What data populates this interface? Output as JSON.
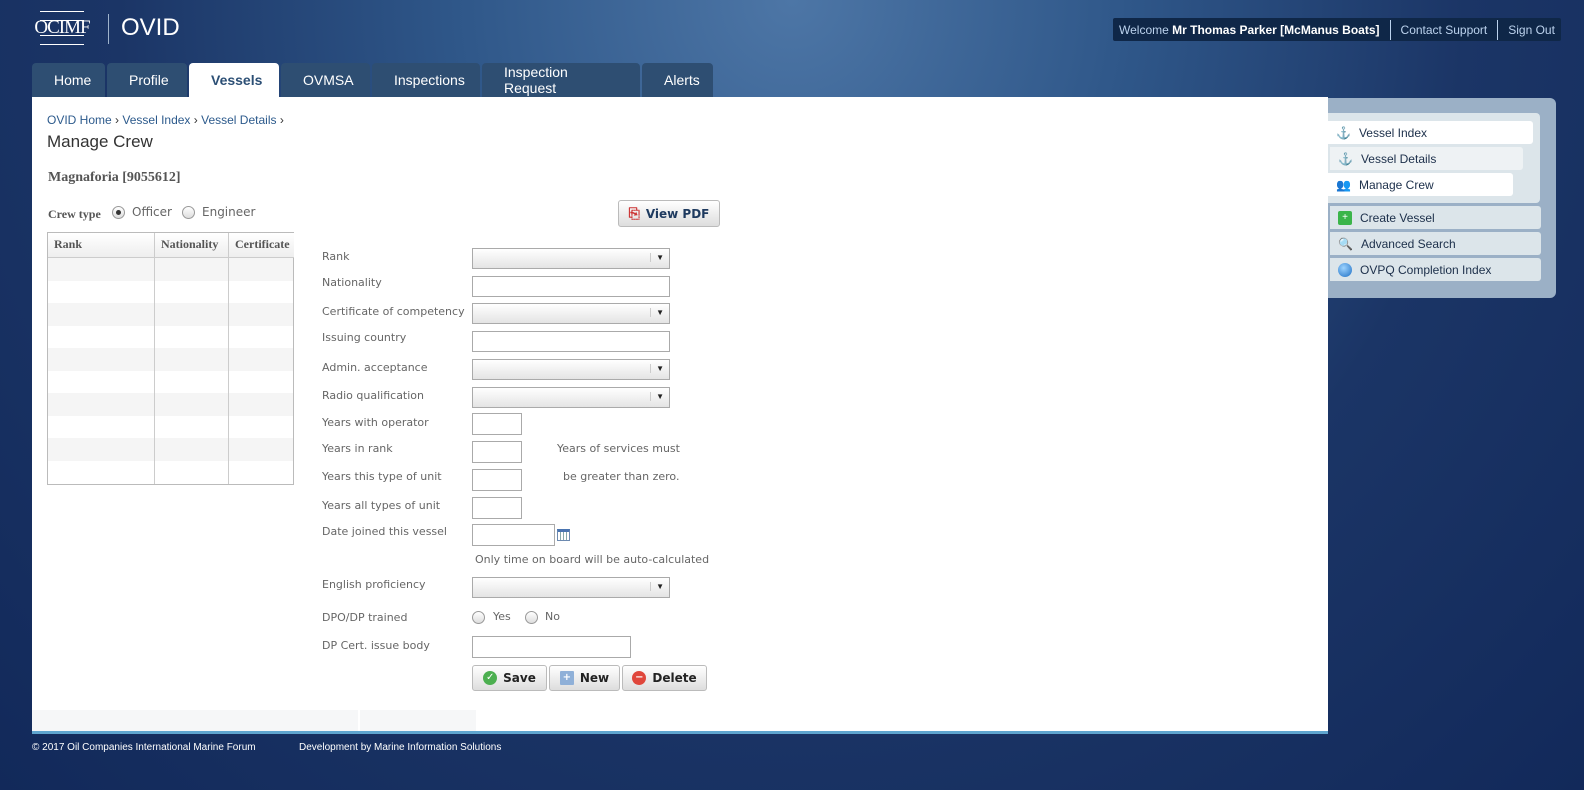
{
  "header": {
    "logo": "OCIMF",
    "app_name": "OVID",
    "welcome": "Welcome",
    "user": "Mr Thomas Parker [McManus Boats]",
    "contact": "Contact Support",
    "signout": "Sign Out"
  },
  "tabs": [
    "Home",
    "Profile",
    "Vessels",
    "OVMSA",
    "Inspections",
    "Inspection Request",
    "Alerts"
  ],
  "active_tab": "Vessels",
  "breadcrumb": [
    "OVID Home",
    "Vessel Index",
    "Vessel Details"
  ],
  "page_title": "Manage Crew",
  "vessel": "Magnaforia [9055612]",
  "crew_type": {
    "label": "Crew type",
    "options": [
      "Officer",
      "Engineer"
    ],
    "selected": "Officer"
  },
  "view_pdf": "View PDF",
  "table": {
    "headers": [
      "Rank",
      "Nationality",
      "Certificate"
    ],
    "rows": []
  },
  "form": {
    "rank": "Rank",
    "nationality": "Nationality",
    "certificate": "Certificate of competency",
    "issuing_country": "Issuing country",
    "admin": "Admin. acceptance",
    "radio": "Radio qualification",
    "years_operator": "Years with operator",
    "years_rank": "Years in rank",
    "years_type": "Years this type of unit",
    "years_all": "Years all types of unit",
    "date_joined": "Date joined this vessel",
    "note1": "Years of services must",
    "note2": "be greater than zero.",
    "note3": "Only time on board will be auto-calculated",
    "english": "English proficiency",
    "dpo": "DPO/DP trained",
    "yes": "Yes",
    "no": "No",
    "dp_body": "DP Cert. issue body"
  },
  "buttons": {
    "save": "Save",
    "new": "New",
    "delete": "Delete"
  },
  "sidebar": {
    "items": [
      "Vessel Index",
      "Vessel Details",
      "Manage Crew"
    ],
    "actions": [
      "Create Vessel",
      "Advanced Search",
      "OVPQ Completion Index"
    ]
  },
  "footer": {
    "copyright": "© 2017 Oil Companies International Marine Forum",
    "dev": "Development by Marine Information Solutions"
  }
}
